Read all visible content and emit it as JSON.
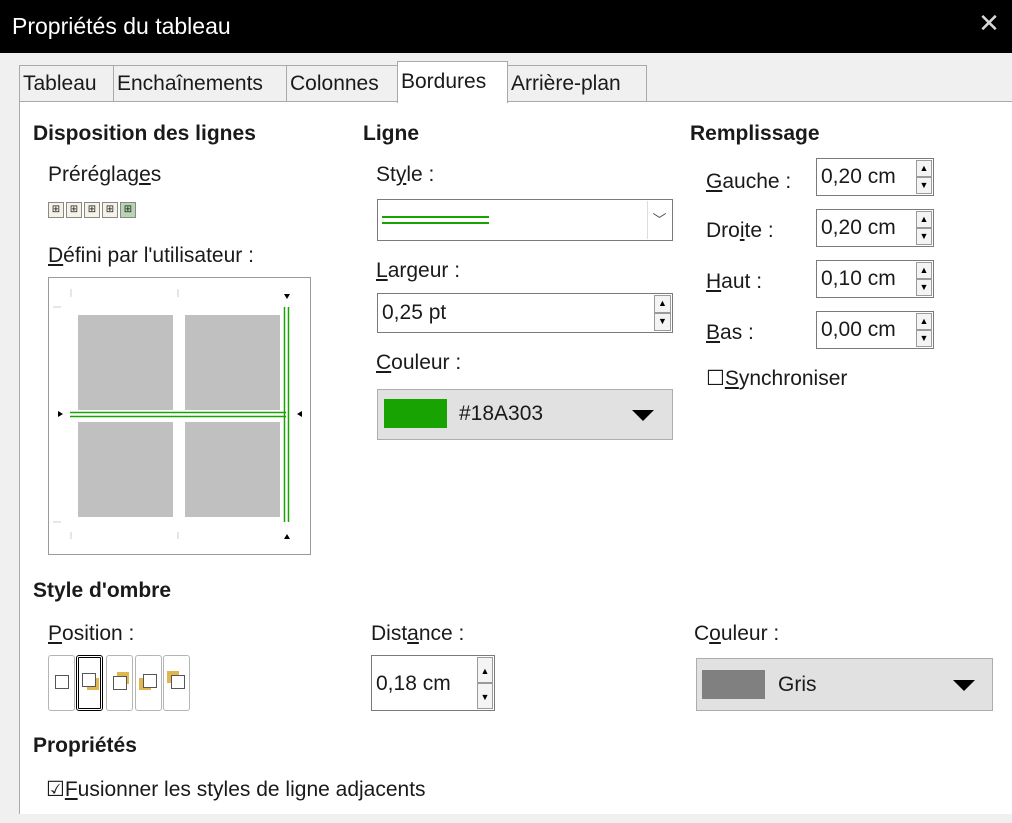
{
  "window": {
    "title": "Propriétés du tableau"
  },
  "tabs": [
    "Tableau",
    "Enchaînements",
    "Colonnes",
    "Bordures",
    "Arrière-plan"
  ],
  "active_tab": "Bordures",
  "line_arrangement": {
    "heading": "Disposition des lignes",
    "presets_label": "Préréglages",
    "user_defined_label": "Défini par l'utilisateur :"
  },
  "line": {
    "heading": "Ligne",
    "style_label": "Style :",
    "width_label": "Largeur :",
    "width_value": "0,25 pt",
    "color_label": "Couleur :",
    "color_value": "#18A303",
    "color_hex": "#18A303"
  },
  "padding": {
    "heading": "Remplissage",
    "left_label": "Gauche :",
    "left_value": "0,20 cm",
    "right_label": "Droite :",
    "right_value": "0,20 cm",
    "top_label": "Haut :",
    "top_value": "0,10 cm",
    "bottom_label": "Bas :",
    "bottom_value": "0,00 cm",
    "sync_label": "Synchroniser",
    "sync_checked": false
  },
  "shadow": {
    "heading": "Style d'ombre",
    "position_label": "Position :",
    "distance_label": "Distance :",
    "distance_value": "0,18 cm",
    "color_label": "Couleur :",
    "color_value": "Gris",
    "color_hex": "#808080"
  },
  "properties": {
    "heading": "Propriétés",
    "merge_label": "Fusionner les styles de ligne adjacents",
    "merge_checked": true
  },
  "icons": [
    "close-icon",
    "spin-up-icon",
    "spin-down-icon",
    "dropdown-arrow-icon",
    "checkbox-icon"
  ]
}
